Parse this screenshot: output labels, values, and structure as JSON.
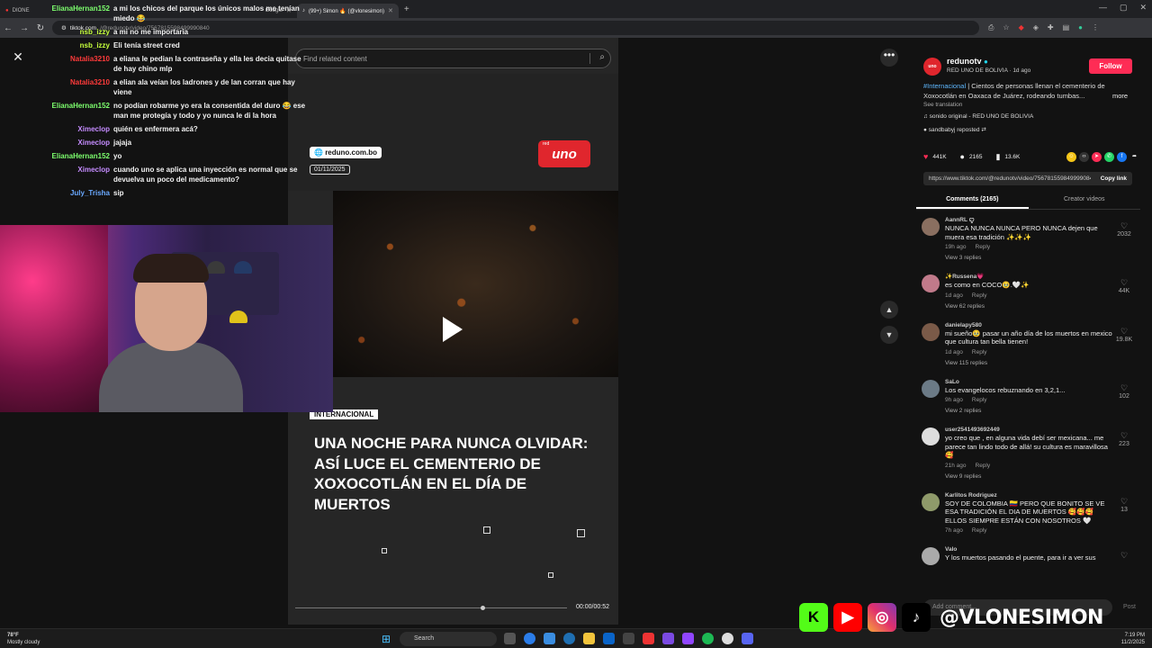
{
  "browser": {
    "tabs": [
      {
        "label": "DIONE",
        "active": false
      },
      {
        "label": "Google",
        "active": false
      },
      {
        "label": "(99+) Simon 🔥 (@vlonesimon)",
        "active": true
      }
    ],
    "url_host": "tiktok.com",
    "url_path": "/@redunotv/video/7567815598499990840"
  },
  "chat": [
    {
      "user": "ElianaHernan152",
      "color": "#7dff6e",
      "msg": "a mi los chicos del parque los únicos malos me tenían miedo 😂"
    },
    {
      "user": "nsb_izzy",
      "color": "#c5ff3c",
      "msg": "a mi no me importaria"
    },
    {
      "user": "nsb_izzy",
      "color": "#c5ff3c",
      "msg": "Eli tenía street cred"
    },
    {
      "user": "Natalia3210",
      "color": "#ff3a3a",
      "msg": "a eliana le pedian la contraseña y ella les decia quitase de hay chino mlp"
    },
    {
      "user": "Natalia3210",
      "color": "#ff3a3a",
      "msg": "a elian ala veían los ladrones y de lan corran que hay viene"
    },
    {
      "user": "ElianaHernan152",
      "color": "#7dff6e",
      "msg": "no podían robarme yo era la consentida del duro 😂 ese man me protegía y todo y yo nunca le di la hora"
    },
    {
      "user": "Ximeclop",
      "color": "#c58cff",
      "msg": "quién es enfermera acá?"
    },
    {
      "user": "Ximeclop",
      "color": "#c58cff",
      "msg": "jajaja"
    },
    {
      "user": "ElianaHernan152",
      "color": "#7dff6e",
      "msg": "yo"
    },
    {
      "user": "Ximeclop",
      "color": "#c58cff",
      "msg": "cuando uno se aplica una inyección es normal que se devuelva un poco del medicamento?"
    },
    {
      "user": "July_Trisha",
      "color": "#6aa9ff",
      "msg": "sip"
    }
  ],
  "video": {
    "search_placeholder": "Find related content",
    "site_badge": "reduno.com.bo",
    "date": "01/11/2025",
    "logo_small": "red",
    "logo_main": "uno",
    "tag": "INTERNACIONAL",
    "headline": "UNA NOCHE PARA NUNCA OLVIDAR: ASÍ LUCE EL CEMENTERIO DE XOXOCOTLÁN EN EL DÍA DE MUERTOS",
    "time": "00:00/00:52",
    "progress": 0.69
  },
  "post": {
    "author": "redunotv",
    "author_sub": "RED UNO DE BOLIVIA · 1d ago",
    "avatar_text": "uno",
    "follow_label": "Follow",
    "hashtag": "#Internacional",
    "caption": " | Cientos de personas llenan el cementerio de Xoxocotlán en Oaxaca de Juárez, rodeando tumbas...",
    "more_label": "more",
    "see_translation": "See translation",
    "sound": "♫  sonido original - RED UNO DE BOLIVIA",
    "repost": "sandbabyj reposted",
    "likes": "441K",
    "comments": "2165",
    "saves": "13.6K",
    "link": "https://www.tiktok.com/@redunotv/video/7567815598499990840",
    "copy_link": "Copy link",
    "tab_comments": "Comments (2165)",
    "tab_creator": "Creator videos",
    "comment_placeholder": "Add comment...",
    "post_label": "Post"
  },
  "comments": [
    {
      "user": "AannRL ꨄ",
      "text": "NUNCA NUNCA NUNCA PERO NUNCA dejen que muera esa tradición ✨✨✨",
      "time": "19h ago",
      "replies": "View 3 replies",
      "likes": "2032",
      "avatar": "#8a6f60"
    },
    {
      "user": "✨Russena💗",
      "text": "es como en COCO🥹.🤍✨",
      "time": "1d ago",
      "replies": "View 62 replies",
      "likes": "44K",
      "avatar": "#c07a8a"
    },
    {
      "user": "danielapy580",
      "text": "mi sueño🥹 pasar un año día de los muertos en mexico que cultura tan bella tienen!",
      "time": "1d ago",
      "replies": "View 115 replies",
      "likes": "19.8K",
      "avatar": "#7a5a48"
    },
    {
      "user": "SaLo",
      "text": "Los evangelocos rebuznando en 3,2,1...",
      "time": "9h ago",
      "replies": "View 2 replies",
      "likes": "102",
      "avatar": "#6b7a86"
    },
    {
      "user": "user2541493692449",
      "text": "yo creo que , en alguna vida debí ser mexicana... me parece tan lindo todo de allá! su cultura es maravillosa 🥰",
      "time": "21h ago",
      "replies": "View 9 replies",
      "likes": "223",
      "avatar": "#dddddd"
    },
    {
      "user": "Karlitos Rodriguez",
      "text": "SOY DE COLOMBIA 🇨🇴 PERO QUE BONITO SE VE ESA TRADICIÓN EL DIA DE MUERTOS 🥰🥰🥰 ELLOS SIEMPRE ESTÁN CON NOSOTROS 🤍",
      "time": "7h ago",
      "replies": "",
      "likes": "13",
      "avatar": "#8f9a6a"
    },
    {
      "user": "Valo",
      "text": "Y los muertos pasando el puente, para ir a ver sus",
      "time": "",
      "replies": "",
      "likes": "",
      "avatar": "#aaaaaa"
    }
  ],
  "social": {
    "handle": "@VLONESIMON",
    "kick": "K",
    "youtube": "▶",
    "instagram": "◎",
    "tiktok": "♪"
  },
  "taskbar": {
    "temp": "78°F",
    "weather": "Mostly cloudy",
    "search": "Search",
    "time": "7:19 PM",
    "date": "11/2/2025"
  },
  "icons": {
    "close": "✕",
    "search": "⌕",
    "play": "play-icon",
    "up": "⌃",
    "down": "⌄",
    "more": "•••",
    "heart": "♥",
    "comment": "💬",
    "bookmark": "🔖",
    "share": "➦"
  }
}
